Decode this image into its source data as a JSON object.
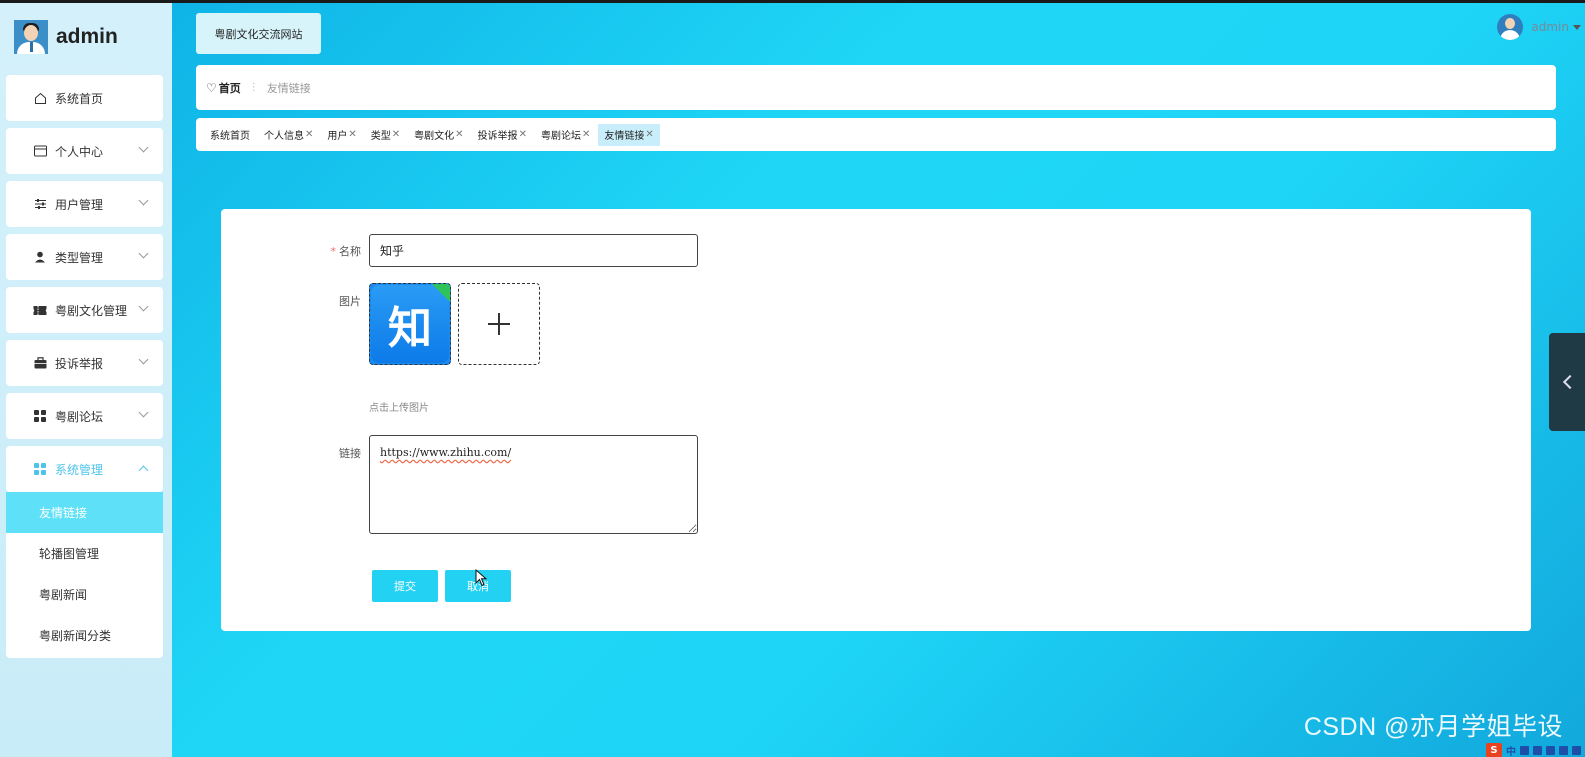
{
  "brand": {
    "title": "admin"
  },
  "header": {
    "site_title": "粤剧文化交流网站",
    "user_name": "admin"
  },
  "sidebar": {
    "items": [
      {
        "label": "系统首页",
        "icon": "home-icon"
      },
      {
        "label": "个人中心",
        "icon": "card-icon"
      },
      {
        "label": "用户管理",
        "icon": "sliders-icon"
      },
      {
        "label": "类型管理",
        "icon": "person-icon"
      },
      {
        "label": "粤剧文化管理",
        "icon": "ticket-icon"
      },
      {
        "label": "投诉举报",
        "icon": "briefcase-icon"
      },
      {
        "label": "粤剧论坛",
        "icon": "grid-icon"
      },
      {
        "label": "系统管理",
        "icon": "grid-icon"
      }
    ],
    "submenu": [
      {
        "label": "友情链接"
      },
      {
        "label": "轮播图管理"
      },
      {
        "label": "粤剧新闻"
      },
      {
        "label": "粤剧新闻分类"
      }
    ]
  },
  "breadcrumb": {
    "home": "首页",
    "current": "友情链接"
  },
  "tabs": [
    {
      "label": "系统首页"
    },
    {
      "label": "个人信息"
    },
    {
      "label": "用户"
    },
    {
      "label": "类型"
    },
    {
      "label": "粤剧文化"
    },
    {
      "label": "投诉举报"
    },
    {
      "label": "粤剧论坛"
    },
    {
      "label": "友情链接"
    }
  ],
  "form": {
    "name_label": "名称",
    "name_value": "知乎",
    "image_label": "图片",
    "image_logo_char": "知",
    "upload_tip": "点击上传图片",
    "link_label": "链接",
    "link_value": "https://www.zhihu.com/",
    "submit_label": "提交",
    "cancel_label": "取消"
  },
  "watermark": "CSDN @亦月学姐毕设",
  "ime": {
    "logo": "S",
    "mode": "中"
  },
  "colors": {
    "accent": "#23d2f2",
    "active_sub": "#5ee1f8",
    "required": "#f56c6c"
  }
}
